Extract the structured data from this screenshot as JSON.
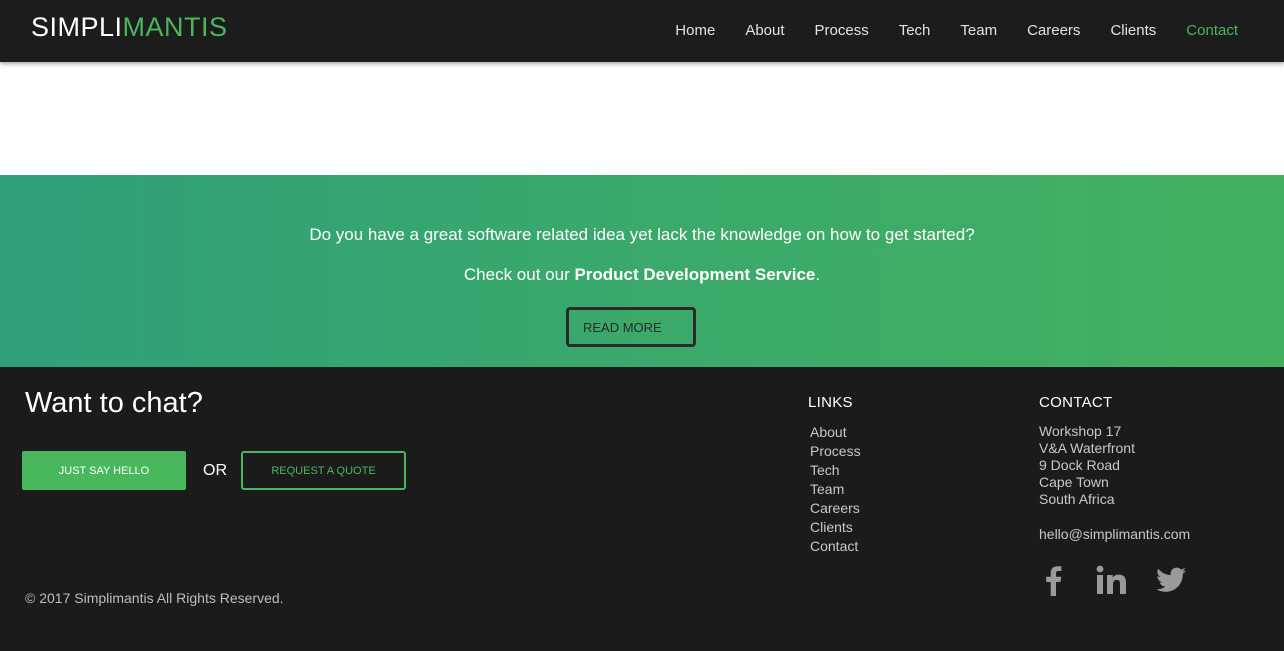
{
  "header": {
    "logo_part1": "SIMPLI",
    "logo_part2": "MANTIS",
    "nav": [
      "Home",
      "About",
      "Process",
      "Tech",
      "Team",
      "Careers",
      "Clients",
      "Contact"
    ],
    "active_nav": "Contact"
  },
  "banner": {
    "line1": "Do you have a great software related idea yet lack the knowledge on how to get started?",
    "line2_prefix": "Check out our ",
    "line2_bold": "Product Development Service",
    "line2_suffix": ".",
    "read_more": "READ MORE"
  },
  "footer": {
    "chat_title": "Want to chat?",
    "hello_button": "JUST SAY HELLO",
    "or_text": "OR",
    "quote_button": "REQUEST A QUOTE",
    "copyright": "© 2017 Simplimantis All Rights Reserved.",
    "links_title": "LINKS",
    "links": [
      "About",
      "Process",
      "Tech",
      "Team",
      "Careers",
      "Clients",
      "Contact"
    ],
    "contact_title": "CONTACT",
    "address": [
      "Workshop 17",
      "V&A Waterfront",
      "9 Dock Road",
      "Cape Town",
      "South Africa"
    ],
    "email": "hello@simplimantis.com",
    "social_icons": [
      "facebook-icon",
      "linkedin-icon",
      "twitter-icon"
    ]
  },
  "colors": {
    "accent_green": "#49b75c",
    "header_bg": "#1c1c1c",
    "footer_bg": "#1b1b1b",
    "banner_gradient_start": "#2fa07a",
    "banner_gradient_end": "#43b05f"
  }
}
